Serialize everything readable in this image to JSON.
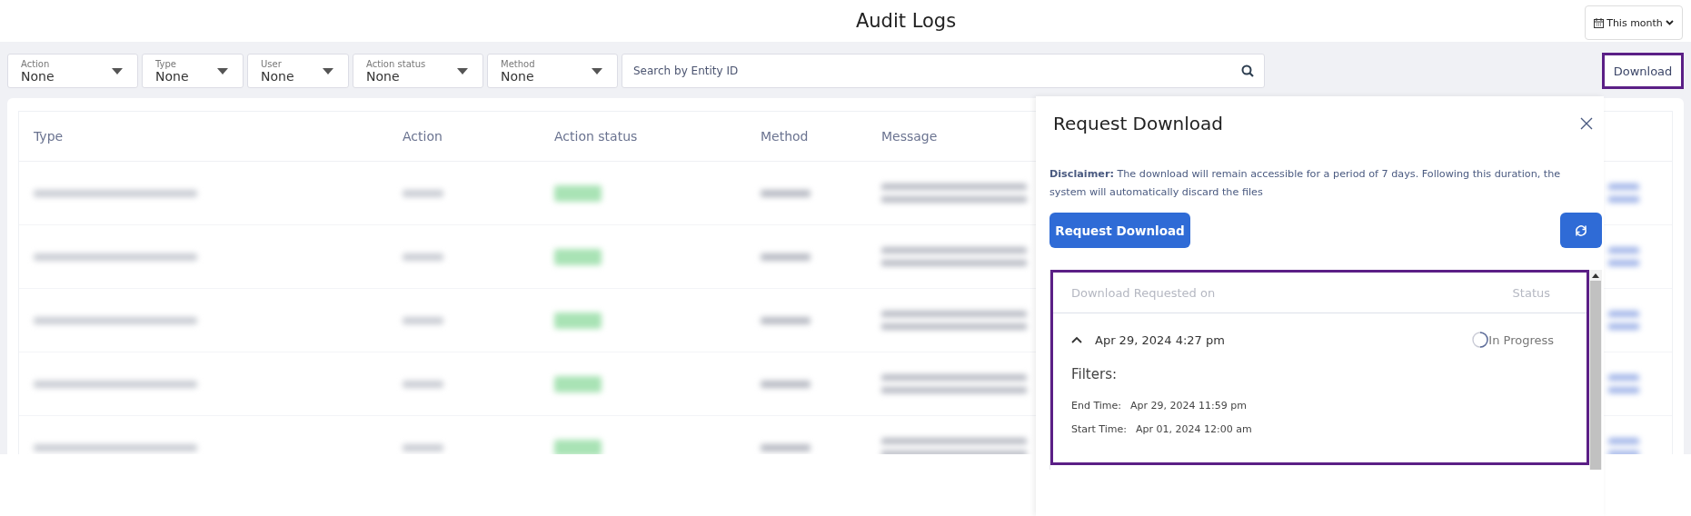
{
  "header": {
    "title": "Audit Logs",
    "date_range": "This month"
  },
  "filters": [
    {
      "label": "Action",
      "value": "None"
    },
    {
      "label": "Type",
      "value": "None"
    },
    {
      "label": "User",
      "value": "None"
    },
    {
      "label": "Action status",
      "value": "None"
    },
    {
      "label": "Method",
      "value": "None"
    }
  ],
  "search": {
    "placeholder": "Search by Entity ID"
  },
  "download_button": {
    "label": "Download",
    "highlighted": true
  },
  "table": {
    "columns": [
      "Type",
      "Action",
      "Action status",
      "Method",
      "Message"
    ],
    "rows": [
      {
        "kind": "redacted"
      },
      {
        "kind": "redacted"
      },
      {
        "kind": "redacted"
      },
      {
        "kind": "redacted"
      },
      {
        "kind": "redacted"
      }
    ]
  },
  "drawer": {
    "title": "Request Download",
    "disclaimer": "**Disclaimer:** The download will remain accessible for a period of 7 days. Following this duration, the system will automatically discard the files",
    "request_button": "Request Download",
    "list": {
      "highlighted": true,
      "columns": [
        "Download Requested on",
        "Status"
      ],
      "items": [
        {
          "requested_on": "Apr 29, 2024 4:27 pm",
          "status": "In Progress",
          "expanded": true,
          "filters_title": "Filters:",
          "filters": [
            {
              "label": "End Time:",
              "value": "Apr 29, 2024 11:59 pm"
            },
            {
              "label": "Start Time:",
              "value": "Apr 01, 2024 12:00 am"
            }
          ]
        }
      ]
    }
  }
}
